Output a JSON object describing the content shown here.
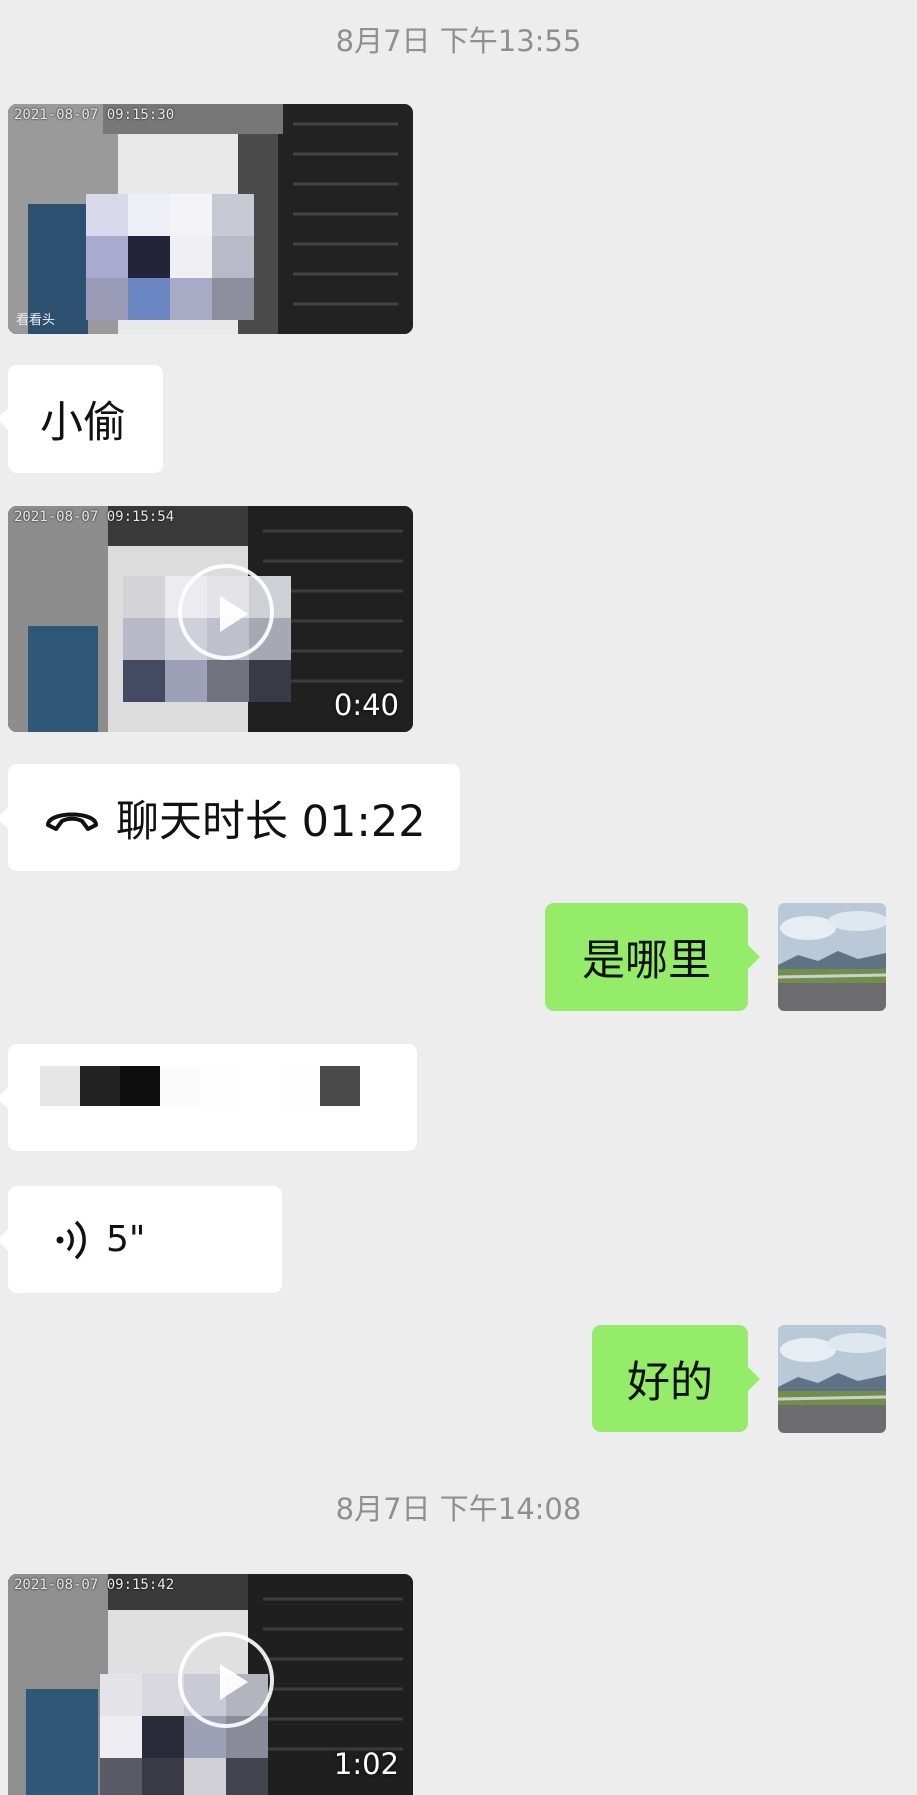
{
  "messages": {
    "timestamp_1": "8月7日 下午13:55",
    "video_1": {
      "overlay_stamp": "2021-08-07 09:15:30",
      "watermark": "看看头"
    },
    "text_1": "小偷",
    "video_2": {
      "overlay_stamp": "2021-08-07 09:15:54",
      "duration": "0:40"
    },
    "call": {
      "label": "聊天时长 01:22",
      "icon": "phone-hangup-icon"
    },
    "reply_1": "是哪里",
    "redacted": {
      "icon": "mosaic-redaction"
    },
    "voice": {
      "duration": "5\"",
      "icon": "voice-wave-icon"
    },
    "reply_2": "好的",
    "timestamp_2": "8月7日 下午14:08",
    "video_3": {
      "overlay_stamp": "2021-08-07 09:15:42",
      "duration": "1:02"
    }
  },
  "colors": {
    "background": "#ededed",
    "incoming_bubble": "#ffffff",
    "outgoing_bubble": "#95ec69",
    "timestamp_text": "#8f8f8f"
  }
}
